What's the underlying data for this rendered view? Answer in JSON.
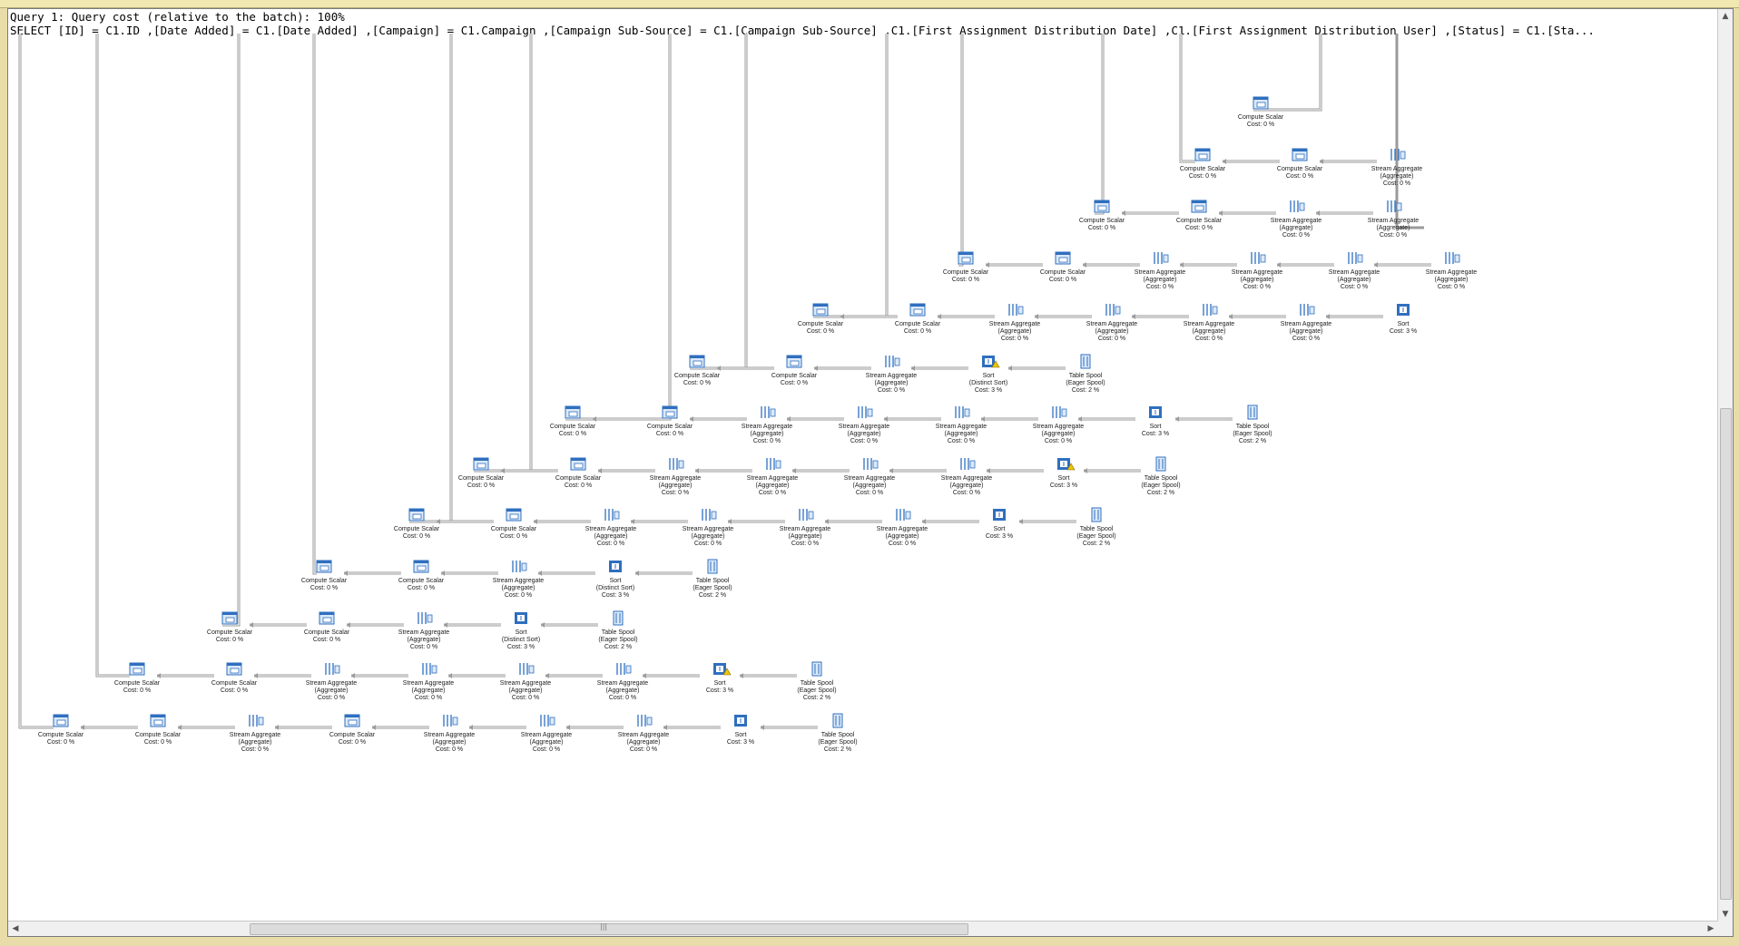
{
  "query_header": {
    "line1": "Query 1: Query cost (relative to the batch): 100%",
    "line2": "SELECT [ID] = C1.ID ,[Date Added] = C1.[Date Added] ,[Campaign] = C1.Campaign ,[Campaign Sub-Source] = C1.[Campaign Sub-Source] ,C1.[First Assignment Distribution Date] ,C1.[First Assignment Distribution User] ,[Status] = C1.[Sta..."
  },
  "operators": {
    "compute_scalar": {
      "name": "Compute Scalar",
      "cost": "Cost: 0 %"
    },
    "stream_aggregate": {
      "name": "Stream Aggregate",
      "sub": "(Aggregate)",
      "cost": "Cost: 0 %"
    },
    "sort": {
      "name": "Sort",
      "cost": "Cost: 3 %"
    },
    "sort_distinct": {
      "name": "Sort",
      "sub": "(Distinct Sort)",
      "cost": "Cost: 3 %"
    },
    "table_spool": {
      "name": "Table Spool",
      "sub": "(Eager Spool)",
      "cost": "Cost: 2 %"
    }
  },
  "plan_rows": [
    {
      "seq": [
        "cs",
        "cs",
        "sa",
        "cs",
        "sa",
        "sa",
        "sa",
        "sort",
        "spool"
      ],
      "warn": false
    },
    {
      "seq": [
        "cs",
        "cs",
        "sa",
        "sa",
        "sa",
        "sa",
        "sort",
        "spool"
      ],
      "warn": true
    },
    {
      "seq": [
        "cs",
        "cs",
        "sa",
        "sortd",
        "spool"
      ],
      "warn": false
    },
    {
      "seq": [
        "cs",
        "cs",
        "sa",
        "sortd",
        "spool"
      ],
      "warn": false
    },
    {
      "seq": [
        "cs",
        "cs",
        "sa",
        "sa",
        "sa",
        "sa",
        "sort",
        "spool"
      ],
      "warn": false
    },
    {
      "seq": [
        "cs",
        "cs",
        "sa",
        "sa",
        "sa",
        "sa",
        "sort",
        "spool"
      ],
      "warn": true
    },
    {
      "seq": [
        "cs",
        "cs",
        "sa",
        "sa",
        "sa",
        "sa",
        "sort",
        "spool"
      ],
      "warn": false
    },
    {
      "seq": [
        "cs",
        "cs",
        "sa",
        "sortd",
        "spool"
      ],
      "warn": true
    },
    {
      "seq": [
        "cs",
        "cs",
        "sa",
        "sa",
        "sa",
        "sa",
        "sort"
      ],
      "warn": false
    },
    {
      "seq": [
        "cs",
        "cs",
        "sa",
        "sa",
        "sa",
        "sa"
      ],
      "warn": false
    },
    {
      "seq": [
        "cs",
        "cs",
        "sa",
        "sa"
      ],
      "warn": false
    },
    {
      "seq": [
        "cs",
        "cs",
        "sa"
      ],
      "warn": false
    },
    {
      "seq": [
        "cs"
      ],
      "warn": false
    }
  ],
  "colors": {
    "accent": "#2f6fbf",
    "icon_light": "#dbe9f8",
    "connector": "#9a9a9a",
    "warning": "#f0c400"
  },
  "scrollbars": {
    "left_arrow": "◀",
    "right_arrow": "▶",
    "up_arrow": "▲",
    "down_arrow": "▼",
    "grip": "|||"
  }
}
